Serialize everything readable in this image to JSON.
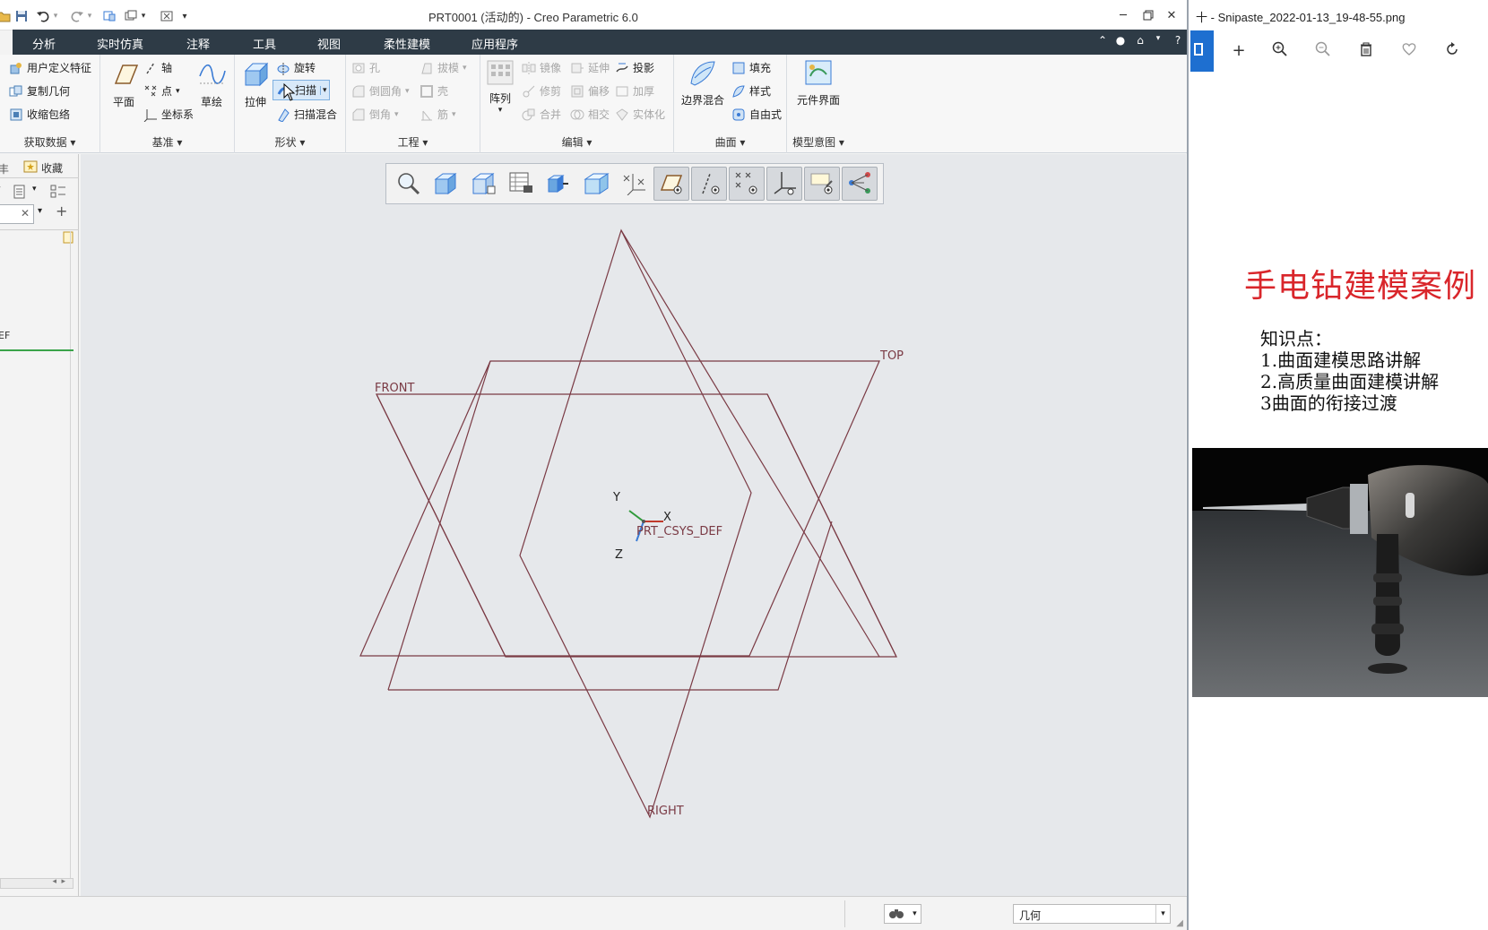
{
  "creo": {
    "window_title": "PRT0001 (活动的) - Creo Parametric 6.0",
    "menu": [
      "分析",
      "实时仿真",
      "注释",
      "工具",
      "视图",
      "柔性建模",
      "应用程序"
    ],
    "groups": {
      "get_data": {
        "label": "获取数据",
        "items": [
          "用户定义特征",
          "复制几何",
          "收缩包络"
        ]
      },
      "datum": {
        "label": "基准",
        "plane": "平面",
        "axis": "轴",
        "point": "点",
        "csys": "坐标系",
        "sketch": "草绘"
      },
      "shapes": {
        "label": "形状",
        "extrude": "拉伸",
        "revolve": "旋转",
        "sweep": "扫描",
        "swept_blend": "扫描混合"
      },
      "engineering": {
        "label": "工程",
        "hole": "孔",
        "draft": "拔模",
        "round": "倒圆角",
        "shell": "壳",
        "chamfer": "倒角",
        "rib": "筋"
      },
      "editing": {
        "label": "编辑",
        "pattern": "阵列",
        "mirror": "镜像",
        "extend": "延伸",
        "project": "投影",
        "trim": "修剪",
        "offset": "偏移",
        "thicken": "加厚",
        "merge": "合并",
        "intersect": "相交",
        "solidify": "实体化"
      },
      "surfaces": {
        "label": "曲面",
        "boundary_blend": "边界混合",
        "fill": "填充",
        "style": "样式",
        "freestyle": "自由式"
      },
      "model_intent": {
        "label": "模型意图",
        "component_interface": "元件界面"
      }
    },
    "left_panel": {
      "tab_favorites": "收藏",
      "tab_left": "丰",
      "tree_item_fragment": "EF"
    },
    "datum_labels": {
      "front": "FRONT",
      "top": "TOP",
      "right": "RIGHT",
      "csys": "PRT_CSYS_DEF",
      "axis_x": "X",
      "axis_y": "Y",
      "axis_z": "Z"
    },
    "status": {
      "filter_value": "几何"
    },
    "colors": {
      "menubar": "#2e3b46",
      "datum_line": "#7a3a44",
      "graphics_bg": "#e6e8eb"
    }
  },
  "viewer": {
    "title": "Snipaste_2022-01-13_19-48-55.png",
    "title_prefix": "十 -",
    "slide": {
      "title": "手电钻建模案例",
      "knowledge_heading": "知识点：",
      "points": [
        "1.曲面建模思路讲解",
        "2.高质量曲面建模讲解",
        "3曲面的衔接过渡"
      ]
    },
    "colors": {
      "slide_title": "#d9262b",
      "accent_tab": "#1e6fd0"
    }
  }
}
